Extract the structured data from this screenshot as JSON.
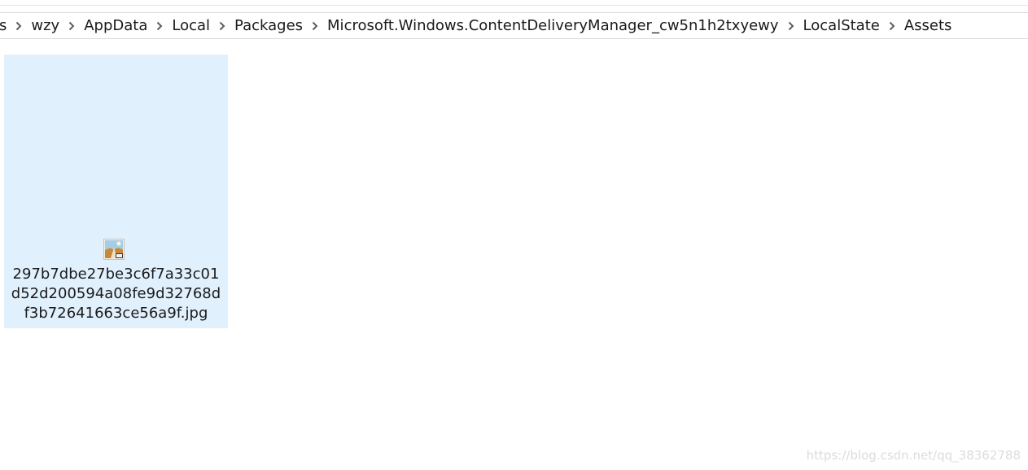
{
  "breadcrumb": {
    "items": [
      {
        "label": "s"
      },
      {
        "label": "wzy"
      },
      {
        "label": "AppData"
      },
      {
        "label": "Local"
      },
      {
        "label": "Packages"
      },
      {
        "label": "Microsoft.Windows.ContentDeliveryManager_cw5n1h2txyewy"
      },
      {
        "label": "LocalState"
      },
      {
        "label": "Assets"
      }
    ],
    "separator_icon": "chevron-right-icon"
  },
  "files": [
    {
      "name_lines": [
        "297b7dbe27be3c6f7a33c01",
        "d52d200594a08fe9d32768d",
        "f3b72641663ce56a9f.jpg"
      ],
      "icon": "jpg-image-thumbnail-icon",
      "selected": true
    }
  ],
  "colors": {
    "selection": "#e1f0fd",
    "text": "#1a1a1a",
    "separator": "#5f5f5f"
  },
  "watermark": "https://blog.csdn.net/qq_38362788"
}
